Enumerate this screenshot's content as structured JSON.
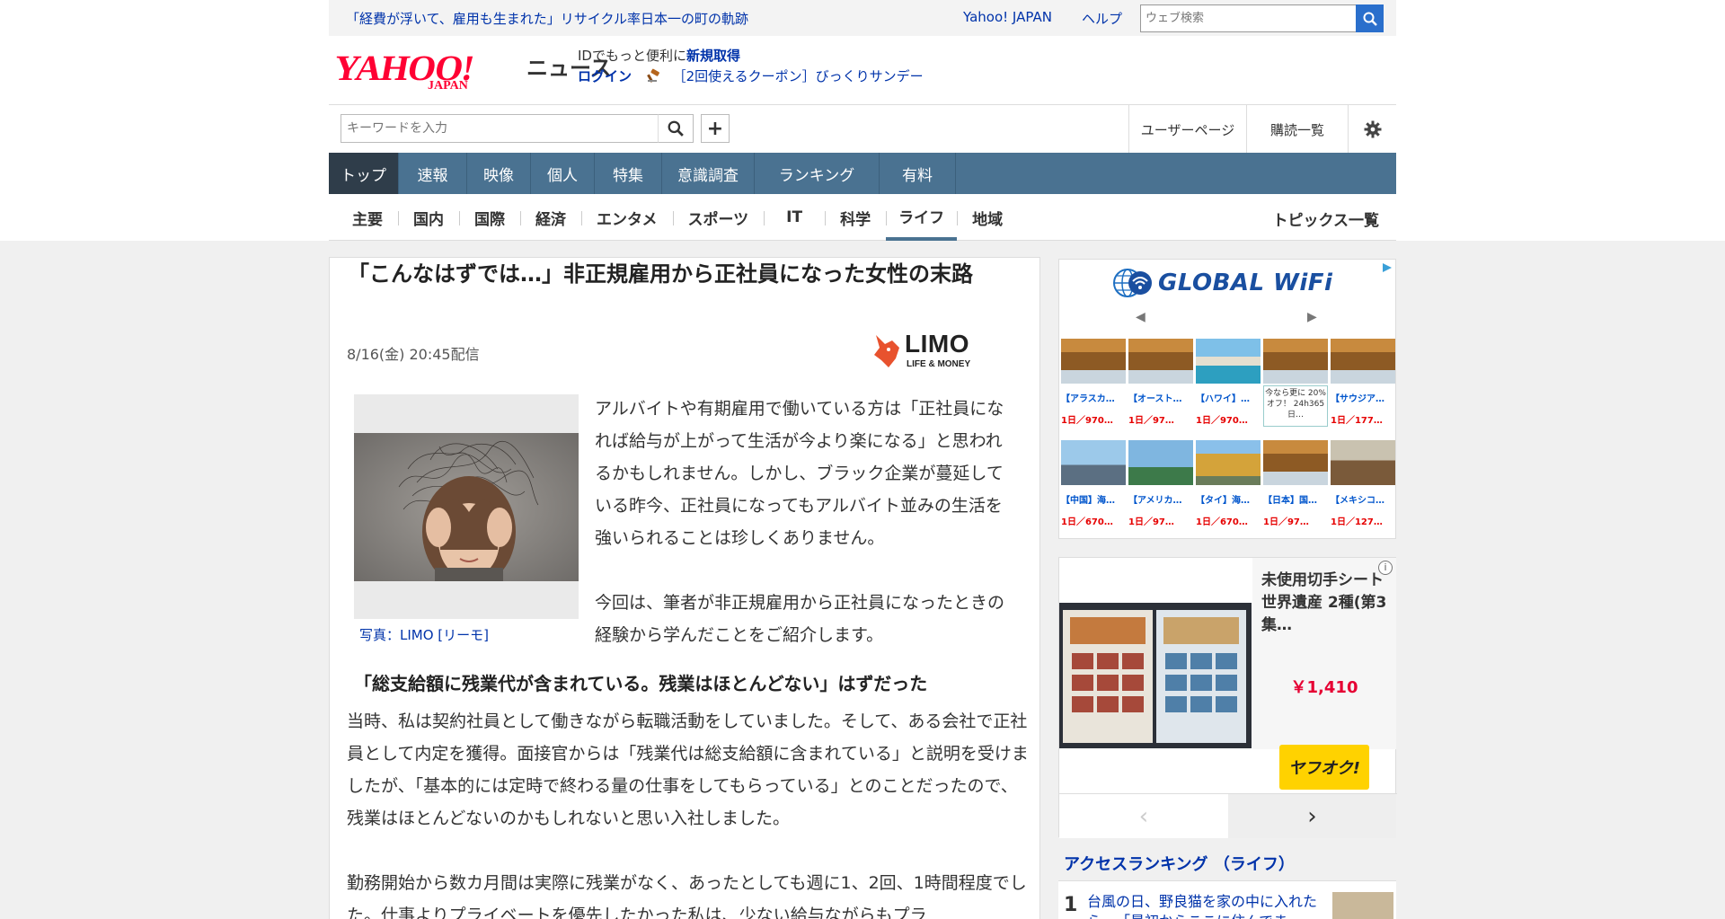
{
  "topbar": {
    "promo": "「経費が浮いて、雇用も生まれた」リサイクル率日本一の町の軌跡",
    "yahoo_japan": "Yahoo! JAPAN",
    "help": "ヘルプ",
    "web_search_placeholder": "ウェブ検索"
  },
  "logo": {
    "main": "YAHOO!",
    "sub": "JAPAN",
    "news": "ニュース"
  },
  "account": {
    "id_text": "IDでもっと便利に",
    "signup": "新規取得",
    "login": "ログイン",
    "coupon": "［2回使えるクーポン］びっくりサンデー"
  },
  "search": {
    "placeholder": "キーワードを入力"
  },
  "user_links": {
    "user_page": "ユーザーページ",
    "subscriptions": "購読一覧"
  },
  "global_nav": [
    "トップ",
    "速報",
    "映像",
    "個人",
    "特集",
    "意識調査",
    "ランキング",
    "有料"
  ],
  "global_nav_active": "トップ",
  "sub_nav": [
    "主要",
    "国内",
    "国際",
    "経済",
    "エンタメ",
    "スポーツ",
    "IT",
    "科学",
    "ライフ",
    "地域"
  ],
  "sub_nav_active": "ライフ",
  "topics_all": "トピックス一覧",
  "article": {
    "title": "「こんなはずでは…」非正規雇用から正社員になった女性の末路",
    "date": "8/16(金) 20:45配信",
    "publisher_logo": "LIMO",
    "publisher_logo_sub": "LIFE & MONEY",
    "photo_caption": "写真：LIMO [リーモ]",
    "lead_p1": "アルバイトや有期雇用で働いている方は「正社員になれば給与が上がって生活が今より楽になる」と思われるかもしれません。しかし、ブラック企業が蔓延している昨今、正社員になってもアルバイト並みの生活を強いられることは珍しくありません。",
    "lead_p2": "今回は、筆者が非正規雇用から正社員になったときの経験から学んだことをご紹介します。",
    "subheading": "「総支給額に残業代が含まれている。残業はほとんどない」はずだった",
    "body_p1": "当時、私は契約社員として働きながら転職活動をしていました。そして、ある会社で正社員として内定を獲得。面接官からは「残業代は総支給額に含まれている」と説明を受けましたが、「基本的には定時で終わる量の仕事をしてもらっている」とのことだったので、残業はほとんどないのかもしれないと思い入社しました。",
    "body_p2": "勤務開始から数カ月間は実際に残業がなく、あったとしても週に1、2回、1時間程度でした。仕事よりプライベートを優先したかった私は、少ない給与ながらもプラ"
  },
  "ad_wifi": {
    "brand": "GLOBAL WiFi",
    "row1": [
      {
        "t1": "【アラスカ…",
        "t2": "1日／970…"
      },
      {
        "t1": "【オースト…",
        "t2": "1日／97…"
      },
      {
        "t1": "【ハワイ】…",
        "t2": "1日／970…"
      },
      {
        "promo": "今なら更に 20%オフ！ 24h365日…"
      },
      {
        "t1": "【サウジア…",
        "t2": "1日／177…"
      }
    ],
    "row2": [
      {
        "t1": "【中国】海…",
        "t2": "1日／670…"
      },
      {
        "t1": "【アメリカ…",
        "t2": "1日／97…"
      },
      {
        "t1": "【タイ】海…",
        "t2": "1日／670…"
      },
      {
        "t1": "【日本】国…",
        "t2": "1日／97…"
      },
      {
        "t1": "【メキシコ…",
        "t2": "1日／127…"
      }
    ]
  },
  "ad_auction": {
    "title": "未使用切手シート 世界遺産 2種(第3集…",
    "price": "￥1,410",
    "brand": "ヤフオク!"
  },
  "ranking": {
    "heading": "アクセスランキング （ライフ）",
    "items": [
      {
        "rank": "1",
        "text": "台風の日、野良猫を家の中に入れたら…「最初からここに住んでま"
      }
    ]
  },
  "colors": {
    "nav_blue": "#4a7291",
    "nav_active": "#2f3d4a",
    "link": "#0033aa",
    "yahoo_red": "#ff0033",
    "price_red": "#e60033"
  }
}
